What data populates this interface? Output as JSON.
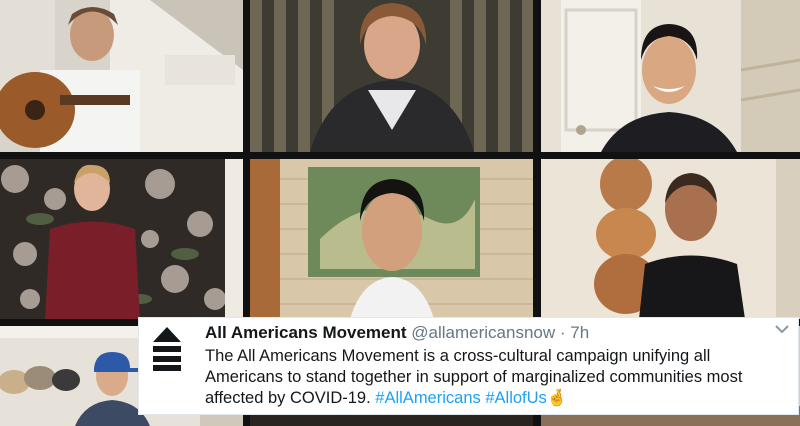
{
  "tweet": {
    "account_name": "All Americans Movement",
    "handle": "@allamericansnow",
    "separator": "·",
    "time": "7h",
    "text_main": "The All Americans Movement is a cross-cultural campaign unifying all Americans to stand together in support of marginalized communities most affected by COVID-19.",
    "hashtag_1": "#AllAmericans",
    "hashtag_2": "#AllofUs",
    "emoji": "🤞",
    "menu_icon": "chevron-down-icon",
    "logo_icon": "eject-icon",
    "link_color": "#1da1f2"
  },
  "video_grid": {
    "tiles": [
      {
        "icon": "participant-guitarist"
      },
      {
        "icon": "participant-woman-curtains"
      },
      {
        "icon": "participant-man-hallway"
      },
      {
        "icon": "participant-man-floral-wall"
      },
      {
        "icon": "participant-man-stone-wall"
      },
      {
        "icon": "participant-man-sculpture"
      },
      {
        "icon": "participant-man-hats"
      },
      {
        "icon": "participant-bottom-center"
      },
      {
        "icon": "participant-bottom-right"
      }
    ]
  }
}
